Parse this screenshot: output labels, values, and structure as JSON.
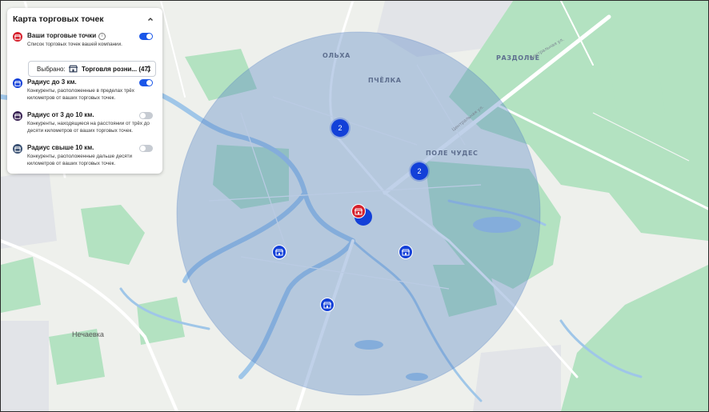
{
  "panel": {
    "title": "Карта торговых точек",
    "own_points": {
      "title": "Ваши торговые точки",
      "description": "Список торговых точек вашей компании.",
      "enabled": true,
      "color": "#d6202c",
      "icon": "store-icon"
    },
    "selector": {
      "label": "Выбрано:",
      "value": "Торговля розни... (47)",
      "icon": "store-icon"
    },
    "layers": [
      {
        "title": "Радиус до 3 км.",
        "description": "Конкуренты, расположенные в пределах трёх километров от ваших торговых точек.",
        "enabled": true,
        "color": "#1340d8"
      },
      {
        "title": "Радиус от 3 до 10 км.",
        "description": "Конкуренты, находящиеся на расстоянии от трёх до десяти километров от ваших торговых точек.",
        "enabled": false,
        "color": "#3a2354"
      },
      {
        "title": "Радиус свыше 10 км.",
        "description": "Конкуренты, расположенные дальше десяти километров от ваших торговых точек.",
        "enabled": false,
        "color": "#3b5274"
      }
    ]
  },
  "map": {
    "labels": {
      "olkha": "ОЛЬХА",
      "pchelka": "ПЧЁЛКА",
      "razdolye": "РАЗДОЛЬЕ",
      "pole_chudes": "ПОЛЕ ЧУДЕС",
      "nechaevka": "Нечаевка",
      "central_st_1": "Центральная ул.",
      "central_st_2": "Центральная ул."
    },
    "clusters": [
      {
        "count": "2"
      },
      {
        "count": "2"
      }
    ],
    "colors": {
      "radius_fill": "#5a86c6",
      "water": "#9fc6e8",
      "forest": "#a9dcb7",
      "road": "#ffffff",
      "marker": "#1340d8"
    }
  }
}
